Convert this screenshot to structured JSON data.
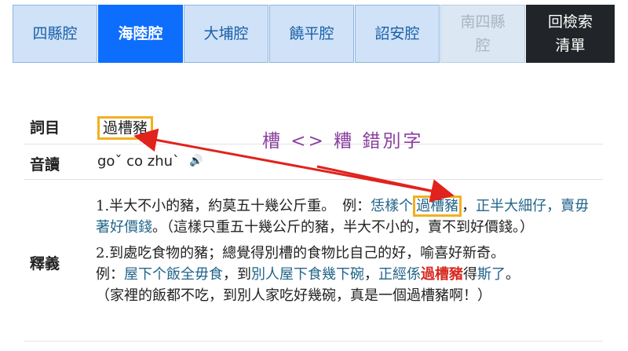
{
  "tabs": [
    {
      "label": "四縣腔",
      "state": "normal"
    },
    {
      "label": "海陸腔",
      "state": "active"
    },
    {
      "label": "大埔腔",
      "state": "normal"
    },
    {
      "label": "饒平腔",
      "state": "normal"
    },
    {
      "label": "詔安腔",
      "state": "normal"
    },
    {
      "label_line1": "南四縣",
      "label_line2": "腔",
      "state": "disabled"
    },
    {
      "label_line1": "回檢索",
      "label_line2": "清單",
      "state": "dark"
    }
  ],
  "entry": {
    "term_label": "詞目",
    "term": "過槽豬",
    "pron_label": "音讀",
    "pron": "goˇ co zhu`",
    "def_label": "釋義",
    "def1": {
      "text": "1.半大不小的豬，約莫五十幾公斤重。　例：",
      "ex_a": "恁樣个",
      "ex_b": "過槽豬",
      "sep": "，",
      "ex_c": "正半大細仔，賣毋著好價錢",
      "trans": "。（這樣只重五十幾公斤的豬，半大不小的，賣不到好價錢。）"
    },
    "def2": {
      "text": "2.到處吃食物的豬；總覺得別槽的食物比自己的好，喻喜好新奇。",
      "ex_label": "例：",
      "ex_a": "屋下个飯全毋食",
      "c1": "，到",
      "ex_b": "別人屋下食幾下碗",
      "c2": "，",
      "ex_c": "正經係",
      "ex_d": "過槽豬",
      "c3": "得",
      "ex_e": "斯了",
      "c4": "。",
      "trans": "（家裡的飯都不吃，到別人家吃好幾碗，真是一個過槽豬啊！）"
    }
  },
  "annotation": {
    "text": "槽 <> 糟 錯別字",
    "color": "#8b3f9f",
    "arrow_color": "#e0231c"
  },
  "colors": {
    "tab_bg": "#cfe2f7",
    "tab_active": "#0d6efd",
    "tab_dark": "#212529",
    "highlight_box": "#f2b01e",
    "example": "#22658a"
  }
}
